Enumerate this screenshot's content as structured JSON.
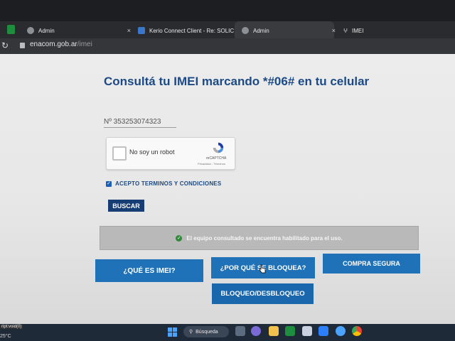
{
  "browser": {
    "tabs": [
      {
        "label": "Admin"
      },
      {
        "label": "Kerio Connect Client - Re: SOLIC"
      },
      {
        "label": "Admin"
      },
      {
        "label": "IMEI"
      }
    ],
    "close_glyph": "×",
    "new_tab_glyph": "+",
    "url_domain": "enacom.gob.ar",
    "url_path": "/imei"
  },
  "page": {
    "title": "Consultá tu IMEI marcando *#06# en tu celular",
    "imei_value": "Nº 353253074323",
    "captcha": {
      "label": "No soy un robot",
      "brand": "reCAPTCHA",
      "links": "Privacidad - Términos"
    },
    "terms_label": "ACEPTO TERMINOS Y CONDICIONES",
    "search_button": "BUSCAR",
    "status_message": "El equipo consultado se encuentra habilitado para el uso.",
    "buttons": {
      "what_is_imei": "¿QUÉ ES IMEI?",
      "why_blocked": "¿POR QUÉ SE BLOQUEA?",
      "safe_purchase": "COMPRA SEGURA",
      "block_unblock": "BLOQUEO/DESBLOQUEO"
    }
  },
  "taskbar": {
    "search_label": "Búsqueda",
    "weather": "25°C",
    "left_label": "ript:void(0)"
  },
  "colors": {
    "title": "#1b4a86",
    "button_blue": "#1f72b8",
    "buscar_dark": "#173e74",
    "status_bg": "#b9b9b9",
    "ok_green": "#2e8b3a"
  }
}
